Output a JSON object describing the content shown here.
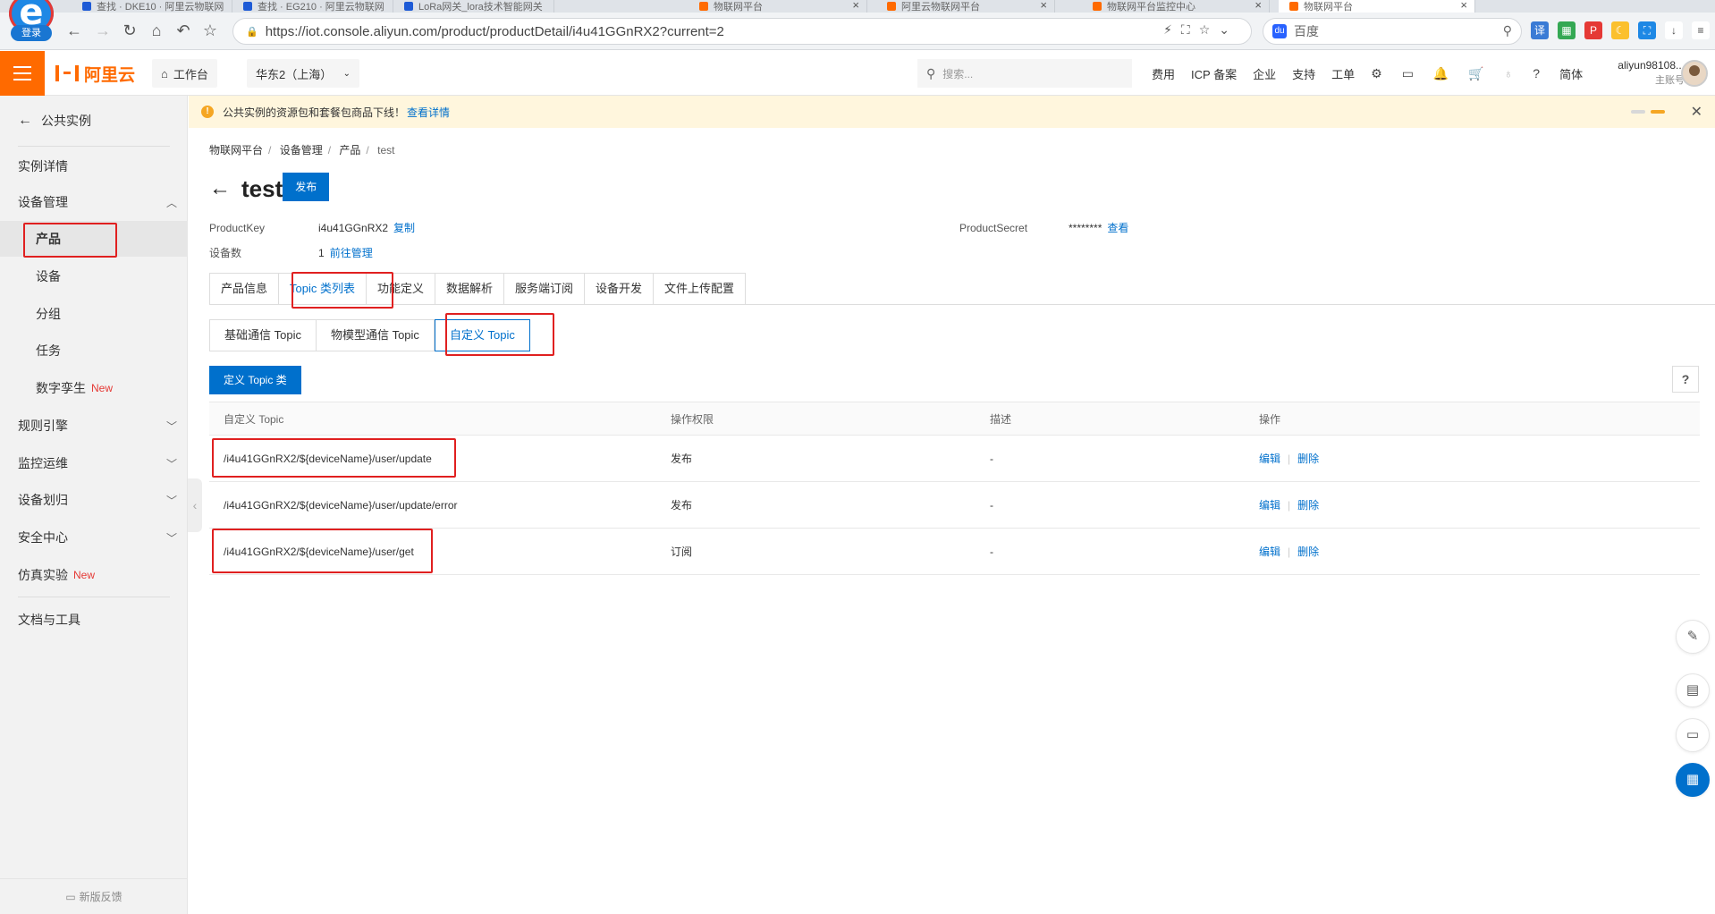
{
  "browser": {
    "tabs": [
      {
        "label": "查找 · DKE10 · 阿里云物联网",
        "color": "#1e5bd6"
      },
      {
        "label": "查找 · EG210 · 阿里云物联网",
        "color": "#1e5bd6"
      },
      {
        "label": "LoRa网关_lora技术智能网关",
        "color": "#1e5bd6"
      },
      {
        "label": "物联网平台",
        "color": "#ff6a00"
      },
      {
        "label": "阿里云物联网平台",
        "color": "#ff6a00"
      },
      {
        "label": "物联网平台监控中心",
        "color": "#ff6a00"
      },
      {
        "label": "物联网平台",
        "color": "#ff6a00"
      }
    ],
    "login_label": "登录",
    "url": "https://iot.console.aliyun.com/product/productDetail/i4u41GGnRX2?current=2",
    "search_engine": "百度"
  },
  "topbar": {
    "brand": "阿里云",
    "workbench": "工作台",
    "region": "华东2（上海）",
    "search_placeholder": "搜索...",
    "links": [
      "费用",
      "ICP 备案",
      "企业",
      "支持",
      "工单"
    ],
    "lang": "简体",
    "user_name": "aliyun98108...",
    "user_role": "主账号"
  },
  "sidebar": {
    "back_label": "公共实例",
    "items": [
      {
        "label": "实例详情"
      },
      {
        "label": "设备管理"
      },
      {
        "label": "产品"
      },
      {
        "label": "设备"
      },
      {
        "label": "分组"
      },
      {
        "label": "任务"
      },
      {
        "label": "数字孪生",
        "tag": "New"
      },
      {
        "label": "规则引擎"
      },
      {
        "label": "监控运维"
      },
      {
        "label": "设备划归"
      },
      {
        "label": "安全中心"
      },
      {
        "label": "仿真实验",
        "tag": "New"
      },
      {
        "label": "文档与工具"
      }
    ],
    "feedback": "新版反馈"
  },
  "notice": {
    "text": "公共实例的资源包和套餐包商品下线！",
    "link": "查看详情"
  },
  "breadcrumb": [
    "物联网平台",
    "设备管理",
    "产品",
    "test"
  ],
  "product": {
    "title": "test",
    "publish_label": "发布",
    "product_key_label": "ProductKey",
    "product_key_value": "i4u41GGnRX2",
    "copy_label": "复制",
    "product_secret_label": "ProductSecret",
    "product_secret_value": "********",
    "view_label": "查看",
    "device_count_label": "设备数",
    "device_count_value": "1",
    "manage_label": "前往管理"
  },
  "tabs": [
    "产品信息",
    "Topic 类列表",
    "功能定义",
    "数据解析",
    "服务端订阅",
    "设备开发",
    "文件上传配置"
  ],
  "subtabs": [
    "基础通信 Topic",
    "物模型通信 Topic",
    "自定义 Topic"
  ],
  "define_button": "定义 Topic 类",
  "help_label": "?",
  "table": {
    "headers": [
      "自定义 Topic",
      "操作权限",
      "描述",
      "操作"
    ],
    "rows": [
      {
        "topic": "/i4u41GGnRX2/${deviceName}/user/update",
        "perm": "发布",
        "desc": "-"
      },
      {
        "topic": "/i4u41GGnRX2/${deviceName}/user/update/error",
        "perm": "发布",
        "desc": "-"
      },
      {
        "topic": "/i4u41GGnRX2/${deviceName}/user/get",
        "perm": "订阅",
        "desc": "-"
      }
    ],
    "edit_label": "编辑",
    "delete_label": "删除"
  },
  "colors": {
    "accent": "#0070cc",
    "brand": "#ff6a00",
    "annotation": "#e02020"
  }
}
